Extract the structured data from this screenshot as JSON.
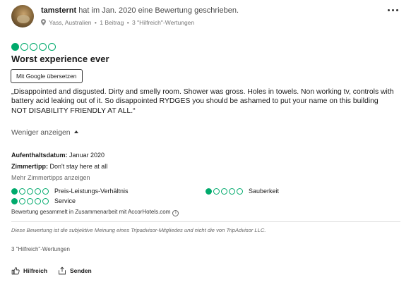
{
  "header": {
    "username": "tamsternt",
    "action_text": "hat im Jan. 2020 eine Bewertung geschrieben.",
    "location": "Yass, Australien",
    "contributions": "1 Beitrag",
    "helpful_votes": "3 \"Hilfreich\"-Wertungen",
    "separator": "•"
  },
  "review": {
    "rating": 1,
    "rating_max": 5,
    "title": "Worst experience ever",
    "translate_label": "Mit Google übersetzen",
    "body_line1": "„Disappointed and disgusted. Dirty and smelly room. Shower was gross. Holes in towels. Non working tv, controls with battery acid leaking out of it. So disappointed RYDGES you should be ashamed to put your name on this building",
    "body_line2": "NOT DISABILITY FRIENDLY AT ALL.“",
    "show_less_label": "Weniger anzeigen"
  },
  "details": {
    "stay_date_label": "Aufenthaltsdatum:",
    "stay_date_value": "Januar 2020",
    "room_tip_label": "Zimmertipp:",
    "room_tip_value": "Don't stay here at all",
    "more_tips_label": "Mehr Zimmertipps anzeigen"
  },
  "sub_ratings": [
    {
      "label": "Preis-Leistungs-Verhältnis",
      "rating": 1
    },
    {
      "label": "Sauberkeit",
      "rating": 1
    },
    {
      "label": "Service",
      "rating": 1
    }
  ],
  "collected_note": "Bewertung gesammelt in Zusammenarbeit mit AccorHotels.com",
  "disclaimer": "Diese Bewertung ist die subjektive Meinung eines Tripadvisor-Mitgliedes und nicht die von TripAdvisor LLC.",
  "helpful_count": "3 \"Hilfreich\"-Wertungen",
  "actions": {
    "helpful_label": "Hilfreich",
    "share_label": "Senden"
  },
  "colors": {
    "bubble_green": "#00aa6c",
    "text": "#1a1a1a"
  },
  "icons": {
    "location": "map-pin-icon",
    "more": "more-dots-icon",
    "info": "info-icon",
    "helpful": "thumbs-up-icon",
    "share": "share-icon",
    "caret": "caret-up-icon"
  }
}
